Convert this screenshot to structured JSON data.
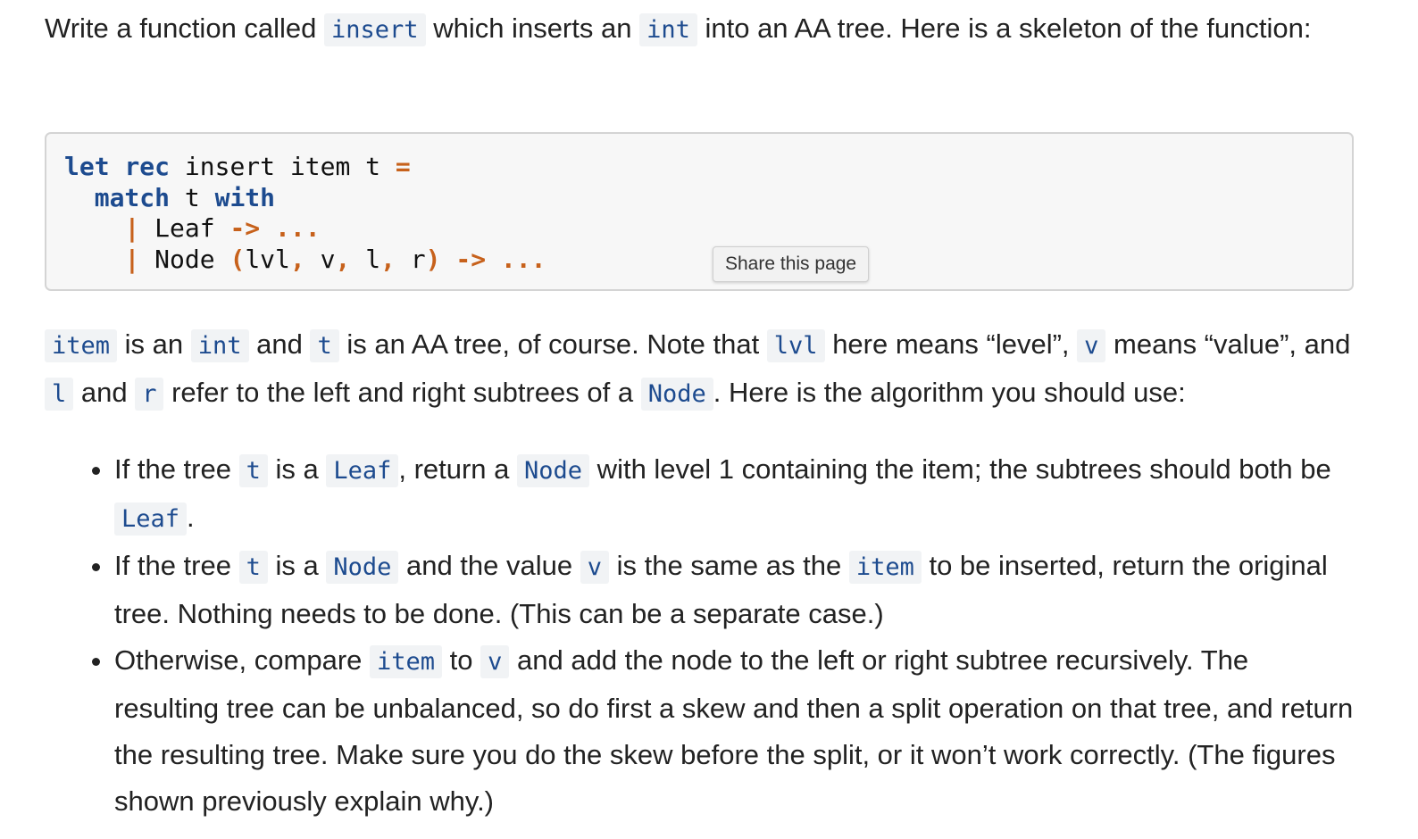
{
  "intro": {
    "t1": "Write a function called ",
    "c1": "insert",
    "t2": " which inserts an ",
    "c2": "int",
    "t3": " into an AA tree. Here is a skeleton of the function:"
  },
  "code": {
    "line1": {
      "kw1": "let",
      "kw2": "rec",
      "text": "insert item t",
      "op": "="
    },
    "line2": {
      "kw1": "match",
      "text": "t",
      "kw2": "with"
    },
    "line3": {
      "bar": "|",
      "text": "Leaf",
      "arrow": "->",
      "dots": "..."
    },
    "line4": {
      "bar": "|",
      "text": "Node",
      "lp": "(",
      "a": "lvl",
      "c1": ",",
      "b": "v",
      "c2": ",",
      "c": "l",
      "c3": ",",
      "d": "r",
      "rp": ")",
      "arrow": "->",
      "dots": "..."
    }
  },
  "share": {
    "label": "Share this page"
  },
  "desc": {
    "c1": "item",
    "t1": " is an ",
    "c2": "int",
    "t2": " and ",
    "c3": "t",
    "t3": " is an AA tree, of course. Note that ",
    "c4": "lvl",
    "t4": " here means “level”, ",
    "c5": "v",
    "t5": " means “value”, and ",
    "c6": "l",
    "t6": " and ",
    "c7": "r",
    "t7": " refer to the left and right subtrees of a ",
    "c8": "Node",
    "t8": ". Here is the algorithm you should use:"
  },
  "bullets": [
    {
      "t1": "If the tree ",
      "c1": "t",
      "t2": " is a ",
      "c2": "Leaf",
      "t3": ", return a ",
      "c3": "Node",
      "t4": " with level 1 containing the item; the subtrees should both be ",
      "c4": "Leaf",
      "t5": "."
    },
    {
      "t1": "If the tree ",
      "c1": "t",
      "t2": " is a ",
      "c2": "Node",
      "t3": " and the value ",
      "c3": "v",
      "t4": " is the same as the ",
      "c4": "item",
      "t5": " to be inserted, return the original tree. Nothing needs to be done. (This can be a separate case.)"
    },
    {
      "t1": "Otherwise, compare ",
      "c1": "item",
      "t2": " to ",
      "c2": "v",
      "t3": " and add the node to the left or right subtree recursively. The resulting tree can be unbalanced, so do first a skew and then a split operation on that tree, and return the resulting tree. Make sure you do the skew before the split, or it won’t work correctly. (The figures shown previously explain why.)"
    }
  ]
}
